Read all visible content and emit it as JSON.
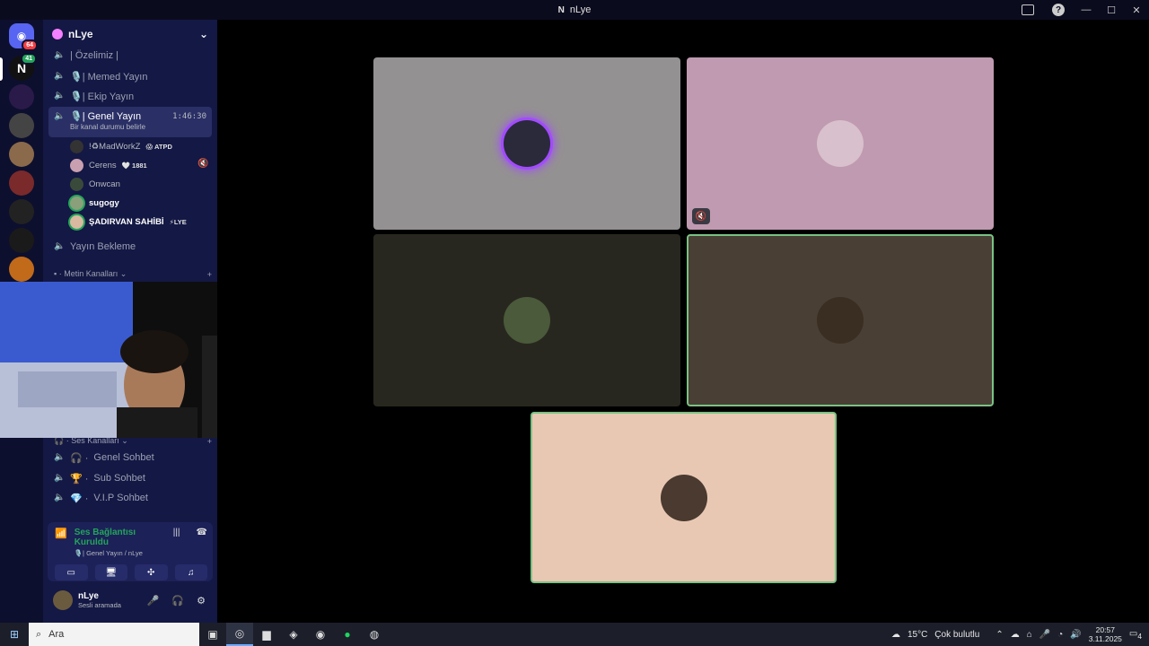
{
  "window": {
    "title": "nLye"
  },
  "guilds": {
    "dm_badge": "64",
    "server_badge": "41"
  },
  "server": {
    "name": "nLye"
  },
  "channels": [
    {
      "label": "| Özelimiz |"
    },
    {
      "label": "🎙️| Memed Yayın"
    },
    {
      "label": "🎙️| Ekip Yayın"
    }
  ],
  "active_channel": {
    "label": "🎙️| Genel Yayın",
    "timer": "1:46:30",
    "status": "Bir kanal durumu belirle"
  },
  "voice_users": [
    {
      "name": "!♻MadWorkZ",
      "tag": "😱 ATPD"
    },
    {
      "name": "Cerens",
      "tag": "🤍 1881"
    },
    {
      "name": "Onwcan",
      "tag": ""
    },
    {
      "name": "sugogy",
      "tag": ""
    },
    {
      "name": "ŞADIRVAN SAHİBİ",
      "tag": "⚡LYE"
    }
  ],
  "waiting_channel": "Yayın Bekleme",
  "categories": {
    "text": "Metin Kanalları",
    "voice": "Ses Kanalları"
  },
  "voice_channels": [
    {
      "label": "Genel Sohbet"
    },
    {
      "label": "Sub Sohbet"
    },
    {
      "label": "V.I.P Sohbet"
    }
  ],
  "voice_panel": {
    "title": "Ses Bağlantısı Kuruldu",
    "subtitle": "🎙️| Genel Yayın / nLye"
  },
  "user_panel": {
    "name": "nLye",
    "status": "Sesli aramada"
  },
  "taskbar": {
    "search_placeholder": "Ara",
    "weather": "15°C",
    "weather_desc": "Çok bulutlu",
    "time": "20:57",
    "date": "3.11.2025",
    "notif_count": "4"
  },
  "colors": {
    "accent": "#5865f2",
    "speaking": "#7ac284",
    "sidebar": "#141844",
    "guildbar": "#0d0f2e"
  }
}
